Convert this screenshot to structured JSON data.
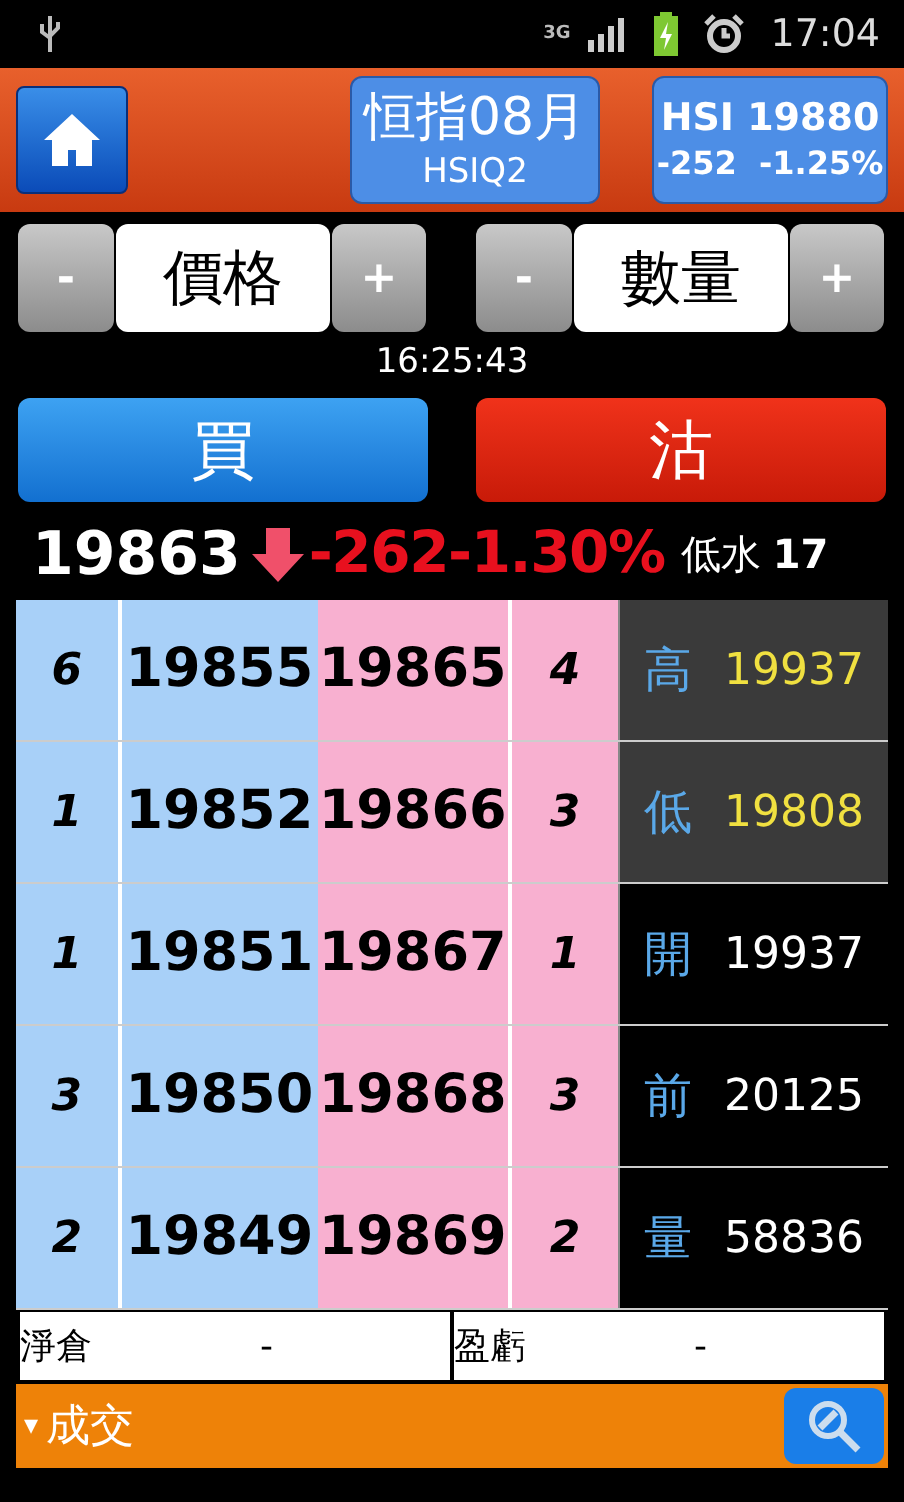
{
  "status_bar": {
    "network": "3G",
    "time": "17:04"
  },
  "header": {
    "contract": "恒指08月",
    "code": "HSIQ2",
    "index_name": "HSI 19880",
    "index_change": "-252  -1.25%"
  },
  "steppers": [
    {
      "minus": "-",
      "label": "價格",
      "plus": "+"
    },
    {
      "minus": "-",
      "label": "數量",
      "plus": "+"
    }
  ],
  "quote_time": "16:25:43",
  "actions": [
    {
      "kind": "buy",
      "label": "買"
    },
    {
      "kind": "sell",
      "label": "沽"
    }
  ],
  "quote": {
    "last": "19863",
    "change": "-262",
    "percent": "-1.30%",
    "basis_label": "低水",
    "basis": "17"
  },
  "depth": [
    {
      "bid_qty": "6",
      "bid": "19855",
      "ask": "19865",
      "ask_qty": "4",
      "stat_label": "高",
      "stat_value": "19937",
      "highlighted": true
    },
    {
      "bid_qty": "1",
      "bid": "19852",
      "ask": "19866",
      "ask_qty": "3",
      "stat_label": "低",
      "stat_value": "19808",
      "highlighted": true
    },
    {
      "bid_qty": "1",
      "bid": "19851",
      "ask": "19867",
      "ask_qty": "1",
      "stat_label": "開",
      "stat_value": "19937",
      "highlighted": false
    },
    {
      "bid_qty": "3",
      "bid": "19850",
      "ask": "19868",
      "ask_qty": "3",
      "stat_label": "前",
      "stat_value": "20125",
      "highlighted": false
    },
    {
      "bid_qty": "2",
      "bid": "19849",
      "ask": "19869",
      "ask_qty": "2",
      "stat_label": "量",
      "stat_value": "58836",
      "highlighted": false
    }
  ],
  "position": [
    {
      "label": "淨倉",
      "value": "-"
    },
    {
      "label": "盈虧",
      "value": "-"
    }
  ],
  "trades_bar": {
    "toggle": "▾",
    "label": "成交"
  }
}
